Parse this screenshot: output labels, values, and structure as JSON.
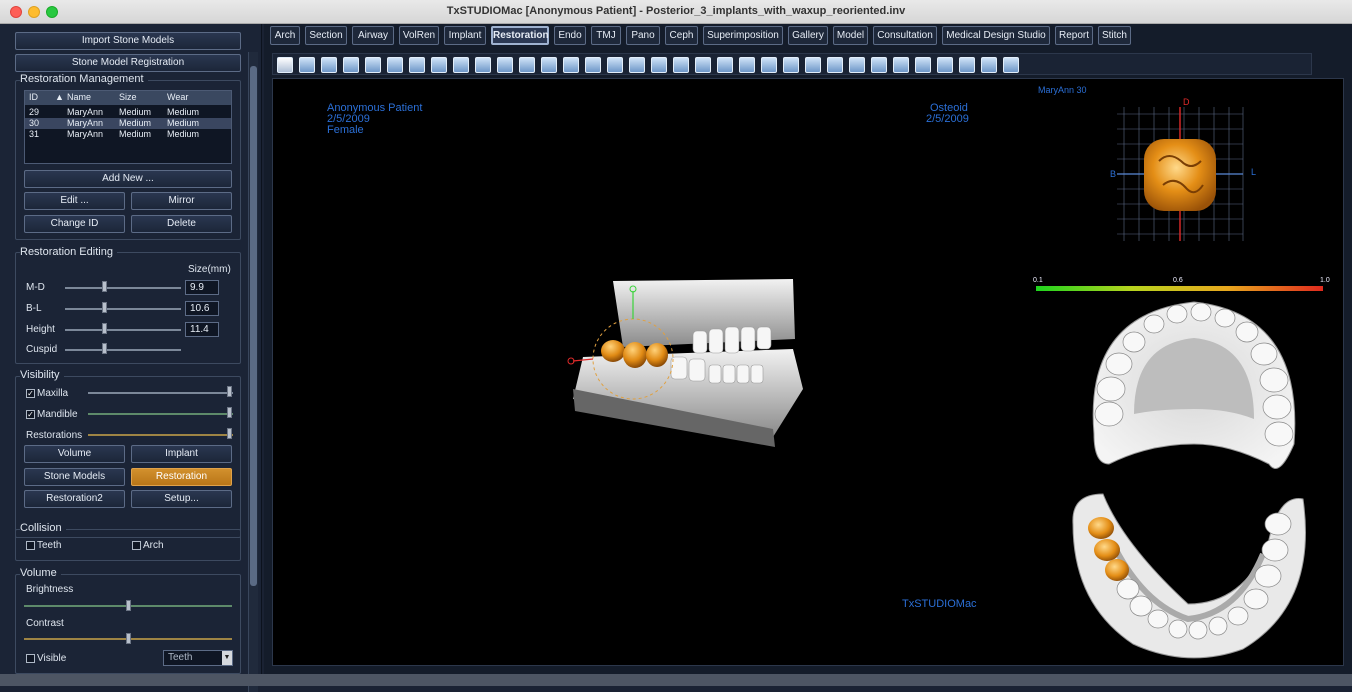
{
  "window": {
    "title": "TxSTUDIOMac [Anonymous Patient] - Posterior_3_implants_with_waxup_reoriented.inv"
  },
  "left": {
    "import_btn": "Import Stone Models",
    "registration_btn": "Stone Model Registration",
    "restoration_mgmt": {
      "title": "Restoration Management",
      "columns": [
        "ID",
        "Name",
        "Size",
        "Wear"
      ],
      "rows": [
        [
          "29",
          "MaryAnn",
          "Medium",
          "Medium"
        ],
        [
          "30",
          "MaryAnn",
          "Medium",
          "Medium"
        ],
        [
          "31",
          "MaryAnn",
          "Medium",
          "Medium"
        ]
      ],
      "add_new": "Add New ...",
      "edit": "Edit ...",
      "mirror": "Mirror",
      "change_id": "Change ID",
      "delete": "Delete"
    },
    "restoration_editing": {
      "title": "Restoration Editing",
      "size_header": "Size(mm)",
      "md_label": "M-D",
      "md_value": "9.9",
      "md_level": 0.35,
      "bl_label": "B-L",
      "bl_value": "10.6",
      "bl_level": 0.35,
      "height_label": "Height",
      "height_value": "11.4",
      "height_level": 0.35,
      "cuspid_label": "Cuspid",
      "cuspid_level": 0.35
    },
    "visibility": {
      "title": "Visibility",
      "maxilla": "Maxilla",
      "maxilla_checked": true,
      "mandible": "Mandible",
      "mandible_checked": true,
      "restorations": "Restorations",
      "volume_btn": "Volume",
      "implant_btn": "Implant",
      "stone_models_btn": "Stone Models",
      "restoration_btn": "Restoration",
      "restoration2_btn": "Restoration2",
      "setup_btn": "Setup..."
    },
    "collision": {
      "title": "Collision",
      "teeth": "Teeth",
      "arch": "Arch"
    },
    "volume": {
      "title": "Volume",
      "brightness": "Brightness",
      "brightness_level": 0.5,
      "contrast": "Contrast",
      "contrast_level": 0.5,
      "visible": "Visible",
      "dropdown_value": "Teeth"
    }
  },
  "tabs": [
    "Arch",
    "Section",
    "Airway",
    "VolRen",
    "Implant",
    "Restoration",
    "Endo",
    "TMJ",
    "Pano",
    "Ceph",
    "Superimposition",
    "Gallery",
    "Model",
    "Consultation",
    "Medical Design Studio",
    "Report",
    "Stitch"
  ],
  "active_tab": "Restoration",
  "viewport": {
    "patient_name": "Anonymous Patient",
    "patient_date": "2/5/2009",
    "patient_sex": "Female",
    "mode": "Osteoid",
    "mode_date": "2/5/2009",
    "model_label": "MaryAnn 30",
    "axis_d": "D",
    "axis_b": "B",
    "axis_l": "L",
    "scale_min": "0.1",
    "scale_mid": "0.6",
    "scale_max": "1.0",
    "watermark": "TxSTUDIOMac"
  },
  "colors": {
    "accent": "#c88623",
    "tooth_gold": "#e2901c",
    "viewport_text": "#2b6fd6"
  }
}
